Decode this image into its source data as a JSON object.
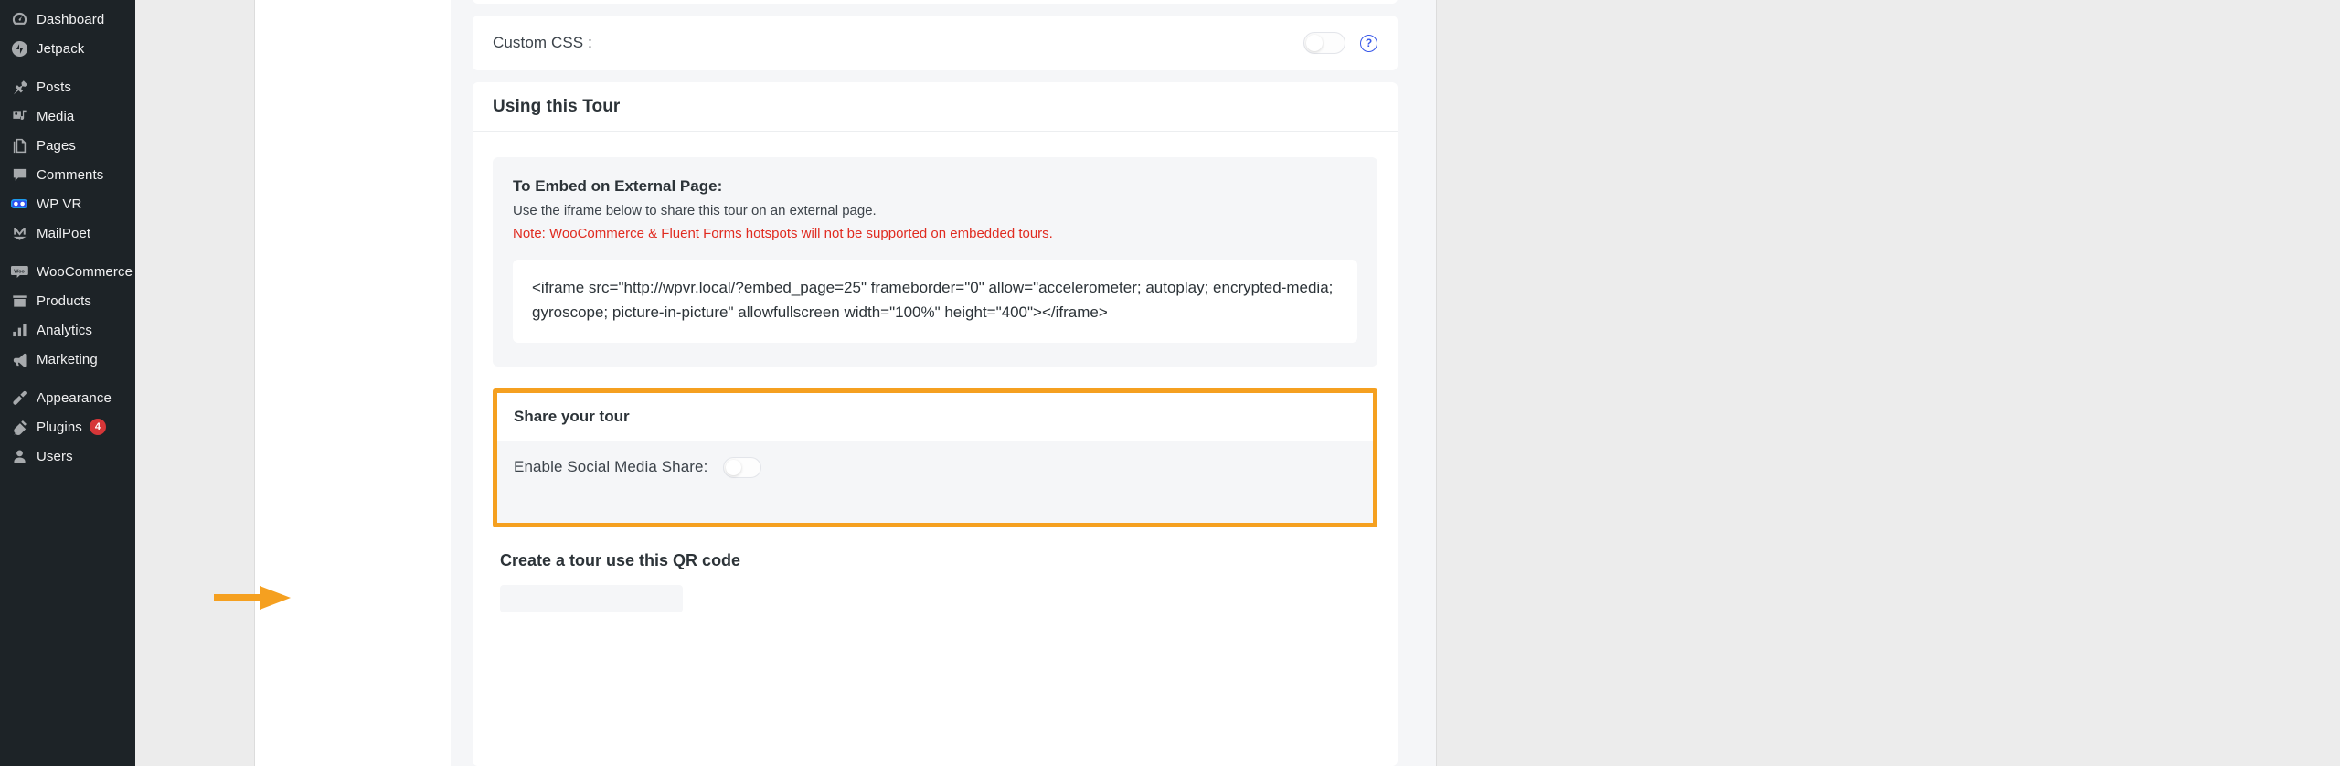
{
  "sidebar": {
    "items": [
      {
        "label": "Dashboard",
        "icon": "dashboard-icon",
        "gap_before": false
      },
      {
        "label": "Jetpack",
        "icon": "jetpack-icon",
        "gap_before": false
      },
      {
        "label": "Posts",
        "icon": "pin-icon",
        "gap_before": true
      },
      {
        "label": "Media",
        "icon": "media-icon",
        "gap_before": false
      },
      {
        "label": "Pages",
        "icon": "pages-icon",
        "gap_before": false
      },
      {
        "label": "Comments",
        "icon": "comments-icon",
        "gap_before": false
      },
      {
        "label": "WP VR",
        "icon": "vr-goggles-icon",
        "gap_before": false
      },
      {
        "label": "MailPoet",
        "icon": "mailpoet-icon",
        "gap_before": false
      },
      {
        "label": "WooCommerce",
        "icon": "woocommerce-icon",
        "gap_before": true
      },
      {
        "label": "Products",
        "icon": "products-icon",
        "gap_before": false
      },
      {
        "label": "Analytics",
        "icon": "analytics-icon",
        "gap_before": false
      },
      {
        "label": "Marketing",
        "icon": "marketing-icon",
        "gap_before": false
      },
      {
        "label": "Appearance",
        "icon": "paintbrush-icon",
        "gap_before": true
      },
      {
        "label": "Plugins",
        "icon": "plug-icon",
        "gap_before": false,
        "badge": "4"
      },
      {
        "label": "Users",
        "icon": "user-icon",
        "gap_before": false
      }
    ]
  },
  "custom_css": {
    "label": "Custom CSS :",
    "toggle_state": "off",
    "help_glyph": "?"
  },
  "using_tour": {
    "title": "Using this Tour",
    "embed": {
      "title": "To Embed on External Page:",
      "description": "Use the iframe below to share this tour on an external page.",
      "note": "Note: WooCommerce & Fluent Forms hotspots will not be supported on embedded tours.",
      "code": "<iframe src=\"http://wpvr.local/?embed_page=25\" frameborder=\"0\" allow=\"accelerometer; autoplay; encrypted-media; gyroscope; picture-in-picture\" allowfullscreen width=\"100%\" height=\"400\"></iframe>"
    },
    "share": {
      "title": "Share your tour",
      "enable_label": "Enable Social Media Share:",
      "toggle_state": "off"
    },
    "qr_heading": "Create a tour use this QR code"
  },
  "annotation": {
    "highlight_color": "#f5a020",
    "arrow_color": "#f5a020"
  }
}
